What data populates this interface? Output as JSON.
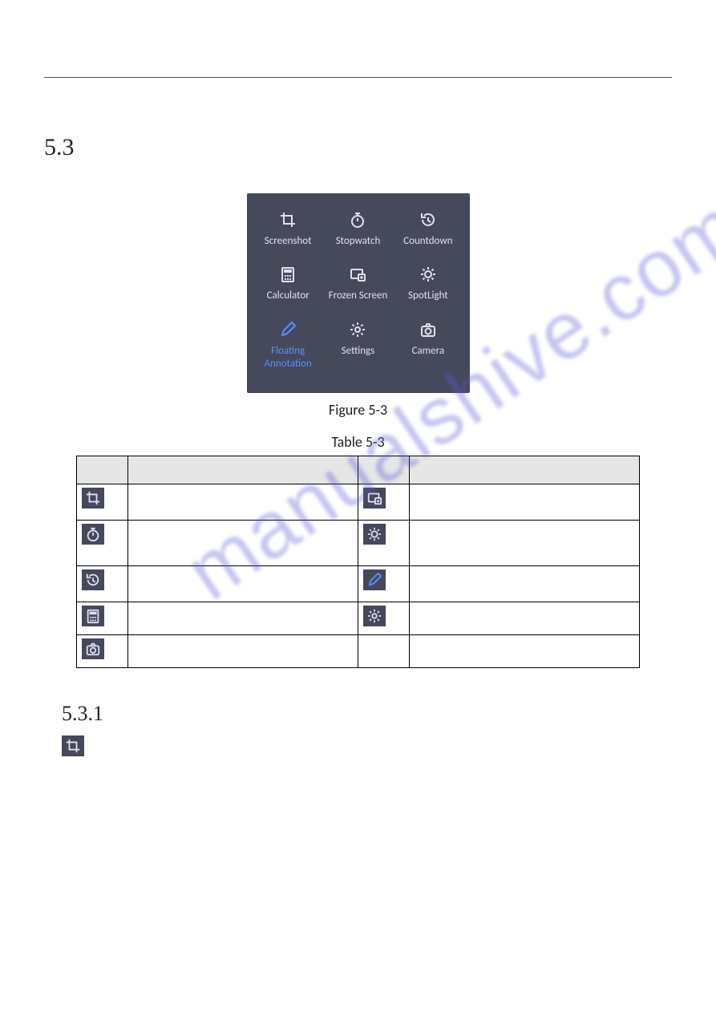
{
  "sectionNumber": "5.3",
  "subSectionNumber": "5.3.1",
  "figureCaption": "Figure 5-3",
  "tableCaption": "Table 5-3",
  "watermark": "manualshive.com",
  "panel": {
    "items": [
      {
        "label": "Screenshot",
        "icon": "crop"
      },
      {
        "label": "Stopwatch",
        "icon": "stopwatch"
      },
      {
        "label": "Countdown",
        "icon": "history"
      },
      {
        "label": "Calculator",
        "icon": "calculator"
      },
      {
        "label": "Frozen Screen",
        "icon": "freeze"
      },
      {
        "label": "SpotLight",
        "icon": "spotlight"
      },
      {
        "label": "Floating Annotation",
        "icon": "pen",
        "active": true
      },
      {
        "label": "Settings",
        "icon": "gear"
      },
      {
        "label": "Camera",
        "icon": "camera"
      }
    ]
  },
  "tableRows": [
    {
      "leftIcon": "crop",
      "rightIcon": "freeze",
      "height": "med"
    },
    {
      "leftIcon": "stopwatch",
      "rightIcon": "spotlight",
      "height": "tall"
    },
    {
      "leftIcon": "history",
      "rightIcon": "pen",
      "rightActive": true,
      "height": "med"
    },
    {
      "leftIcon": "calculator",
      "rightIcon": "gear",
      "height": "short"
    },
    {
      "leftIcon": "camera",
      "rightIcon": "",
      "height": "short"
    }
  ],
  "subSectionIcon": "crop"
}
